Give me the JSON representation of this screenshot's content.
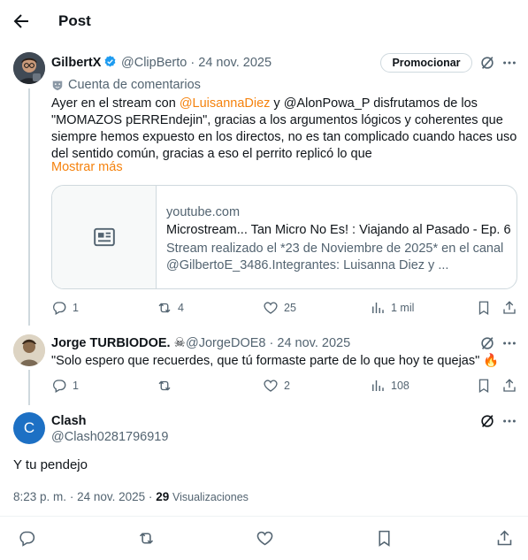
{
  "header": {
    "title": "Post"
  },
  "post1": {
    "author_name": "GilbertX",
    "handle": "@ClipBerto",
    "separator": "·",
    "date": "24 nov. 2025",
    "promote_label": "Promocionar",
    "community_label": "Cuenta de comentarios",
    "text": {
      "p1": "Ayer en el stream con ",
      "mention1": "@LuisannaDiez",
      "p2": " y @AlonPowa_P disfrutamos de los",
      "line2": "\"MOMAZOS pERREndejin\", gracias a los argumentos lógicos y coherentes que",
      "line3": "siempre hemos expuesto en los directos, no es tan complicado cuando haces uso",
      "line4": "del sentido común, gracias a eso el perrito replicó lo que"
    },
    "show_more": "Mostrar más",
    "card": {
      "domain": "youtube.com",
      "title": "Microstream... Tan Micro No Es! : Viajando al Pasado - Ep. 6",
      "desc_line1": "Stream realizado el *23 de Noviembre de 2025* en el canal",
      "desc_line2": "@GilbertoE_3486.Integrantes: Luisanna Diez y ..."
    },
    "stats": {
      "replies": "1",
      "reposts": "4",
      "likes": "25",
      "views": "1 mil"
    }
  },
  "post2": {
    "author_name": "Jorge TURBIODOE.",
    "name_emoji": "☠",
    "handle": "@JorgeDOE8",
    "separator": "·",
    "date": "24 nov. 2025",
    "text": "\"Solo espero que recuerdes, que tú formaste parte de lo que hoy te quejas\"",
    "emoji": "🔥",
    "stats": {
      "replies": "1",
      "reposts": "",
      "likes": "2",
      "views": "108"
    }
  },
  "main_post": {
    "author_name": "Clash",
    "avatar_letter": "C",
    "handle": "@Clash0281796919",
    "text": "Y tu pendejo",
    "time": "8:23 p. m.",
    "separator": "·",
    "date": "24 nov. 2025",
    "separator2": "·",
    "views_count": "29",
    "views_label": "Visualizaciones"
  },
  "colors": {
    "link": "#f5820d",
    "verified": "#1d9bf0",
    "muted": "#536471",
    "border": "#cfd9de"
  },
  "icons": [
    "back-arrow-icon",
    "verified-badge-icon",
    "grok-icon",
    "more-icon",
    "community-icon",
    "article-icon",
    "reply-icon",
    "repost-icon",
    "like-icon",
    "views-icon",
    "bookmark-icon",
    "share-icon",
    "skull-icon",
    "fire-icon"
  ]
}
